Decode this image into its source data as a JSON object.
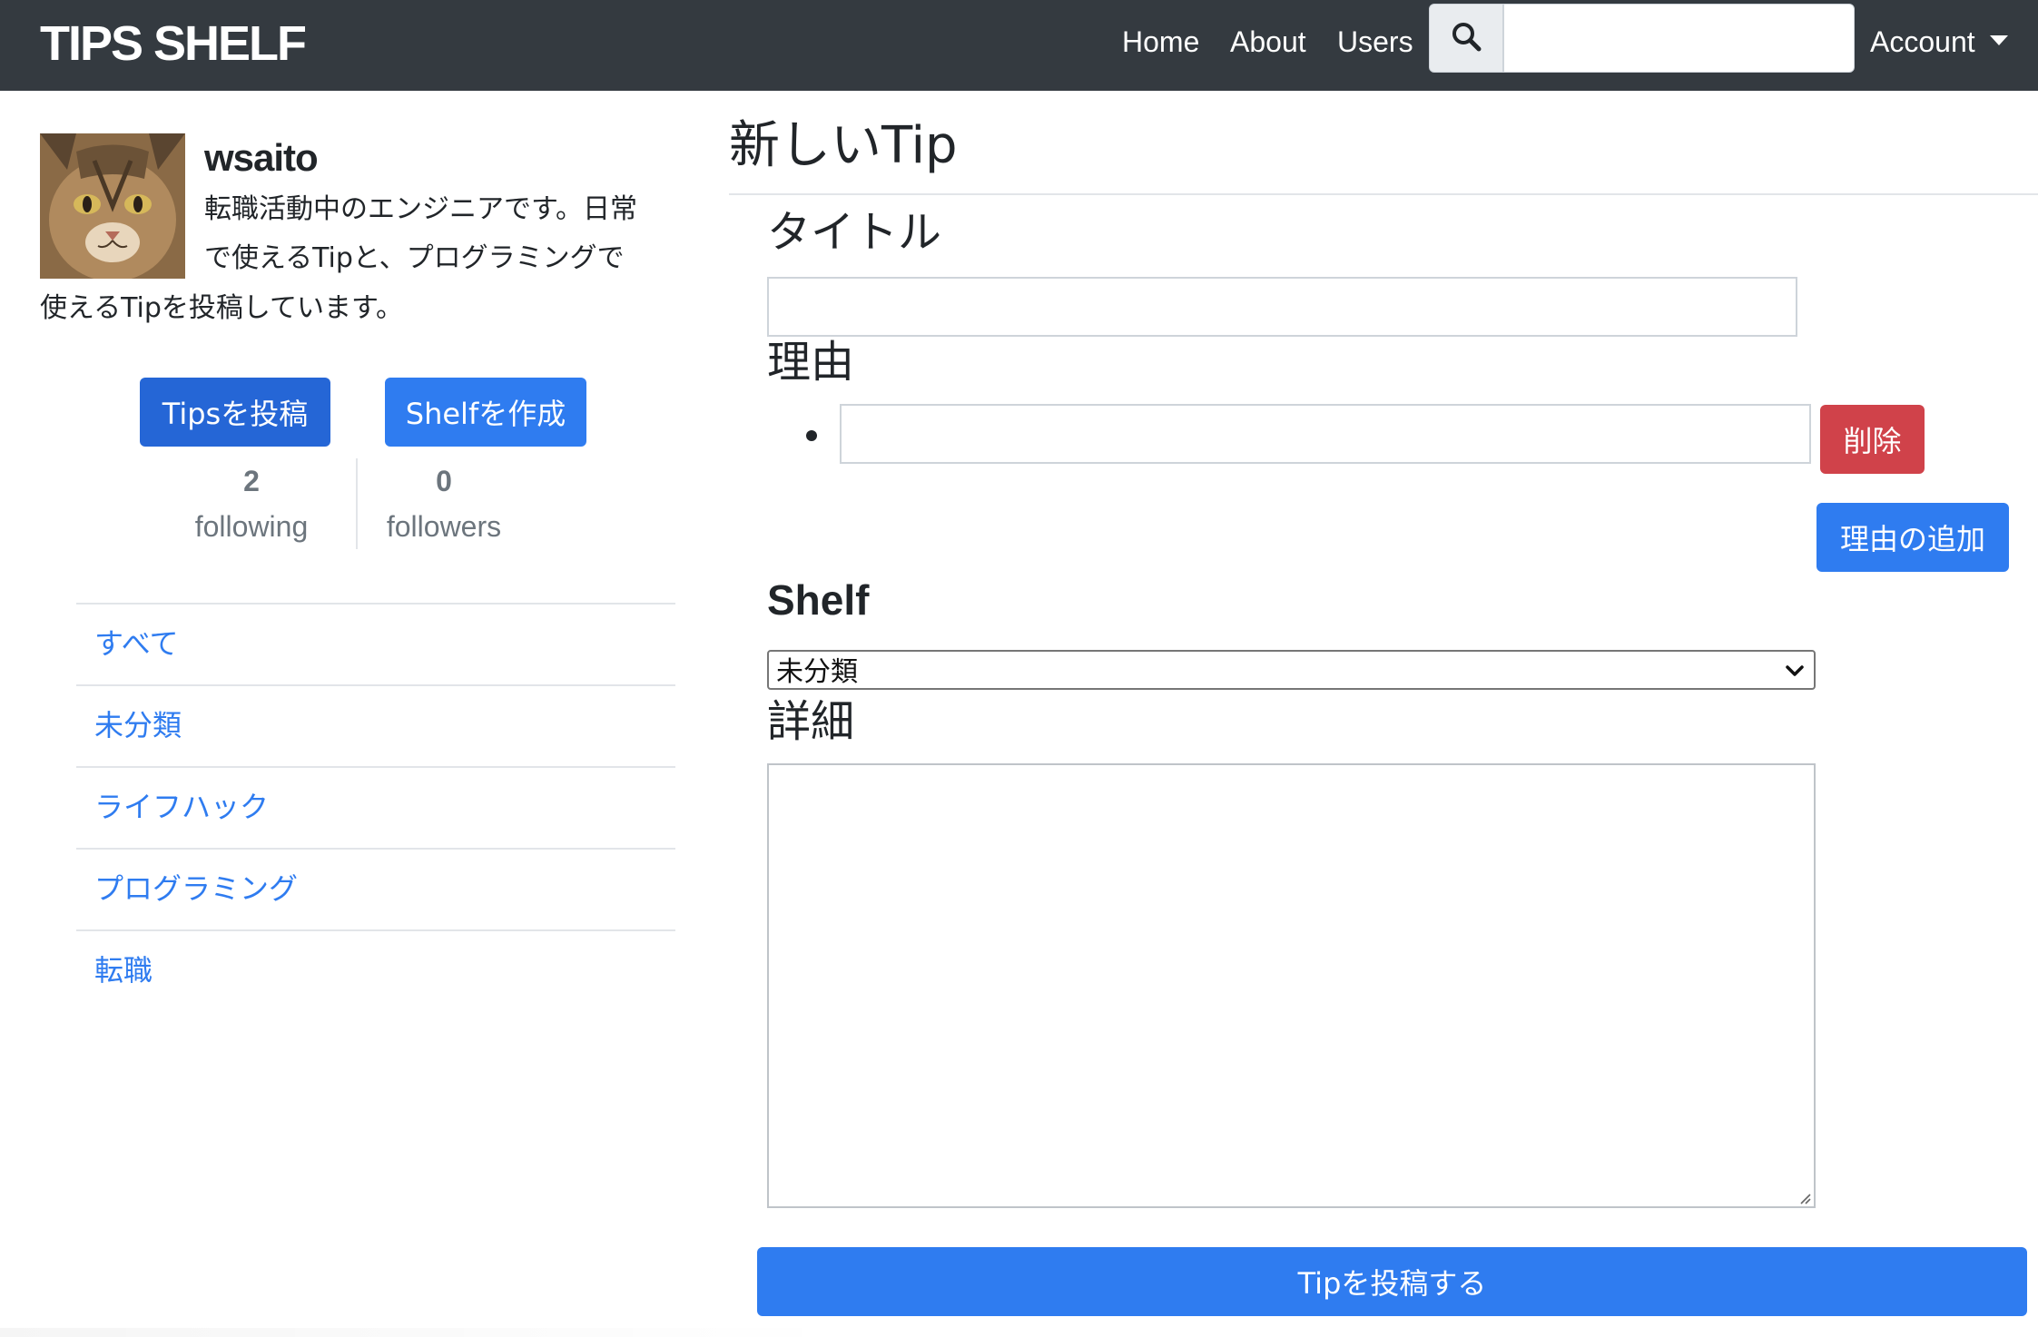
{
  "navbar": {
    "brand": "TIPS SHELF",
    "links": [
      {
        "label": "Home"
      },
      {
        "label": "About"
      },
      {
        "label": "Users"
      }
    ],
    "search_icon": "search-icon",
    "search_value": "",
    "account_label": "Account"
  },
  "profile": {
    "avatar": "cat-avatar",
    "username": "wsaito",
    "bio_lines": [
      "転職活動中のエンジニアです。日常",
      "で使えるTipと、プログラミングで",
      "使えるTipを投稿しています。"
    ],
    "post_tips_label": "Tipsを投稿",
    "create_shelf_label": "Shelfを作成",
    "following_count": "2",
    "following_label": "following",
    "followers_count": "0",
    "followers_label": "followers"
  },
  "shelves": [
    {
      "label": "すべて"
    },
    {
      "label": "未分類"
    },
    {
      "label": "ライフハック"
    },
    {
      "label": "プログラミング"
    },
    {
      "label": "転職"
    }
  ],
  "form": {
    "page_title": "新しいTip",
    "title_label": "タイトル",
    "title_value": "",
    "reason_label": "理由",
    "reason_value": "",
    "delete_label": "削除",
    "add_reason_label": "理由の追加",
    "shelf_label": "Shelf",
    "shelf_selected": "未分類",
    "detail_label": "詳細",
    "detail_value": "",
    "submit_label": "Tipを投稿する"
  },
  "colors": {
    "navbar_bg": "#343a40",
    "primary": "#2f7cf0",
    "danger": "#d0424a",
    "link": "#2f7cf0",
    "muted": "#6c757d"
  }
}
